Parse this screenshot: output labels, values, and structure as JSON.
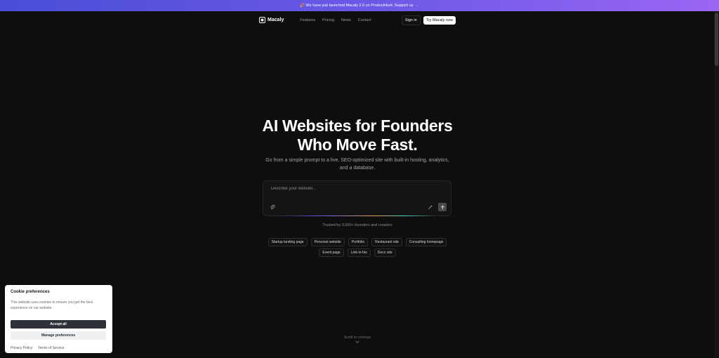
{
  "banner": {
    "icon": "party-popper",
    "text": "🎉 We have just launched Macaly 2.0 on ProductHunt. Support us",
    "arrow": "→"
  },
  "nav": {
    "logo_text": "Macaly",
    "links": [
      "Features",
      "Pricing",
      "News",
      "Contact"
    ],
    "sign_in": "Sign in",
    "try_now": "Try Macaly now"
  },
  "hero": {
    "title_line1": "AI Websites for Founders",
    "title_line2": "Who Move Fast.",
    "subtitle": "Go from a simple prompt to a live, SEO-optimized site with built-in hosting, analytics, and a database."
  },
  "prompt": {
    "placeholder": "Describe your website..."
  },
  "trusted": "Trusted by 3,000+ founders and creators",
  "chips_row1": [
    "Startup landing page",
    "Personal website",
    "Portfolio",
    "Restaurant site",
    "Consulting homepage"
  ],
  "chips_row2": [
    "Event page",
    "Link-in-bio",
    "Deco site"
  ],
  "scroll_hint": "Scroll to continue",
  "cookie": {
    "title": "Cookie preferences",
    "text": "This website uses cookies to ensure you get the best experience on our website.",
    "accept": "Accept all",
    "manage": "Manage preferences",
    "privacy": "Privacy Policy",
    "terms": "Terms of Service"
  },
  "colors": {
    "background": "#0e0e0e",
    "banner_start": "#4a4ed8",
    "banner_end": "#9a66f3",
    "accept_button": "#2e3238"
  }
}
